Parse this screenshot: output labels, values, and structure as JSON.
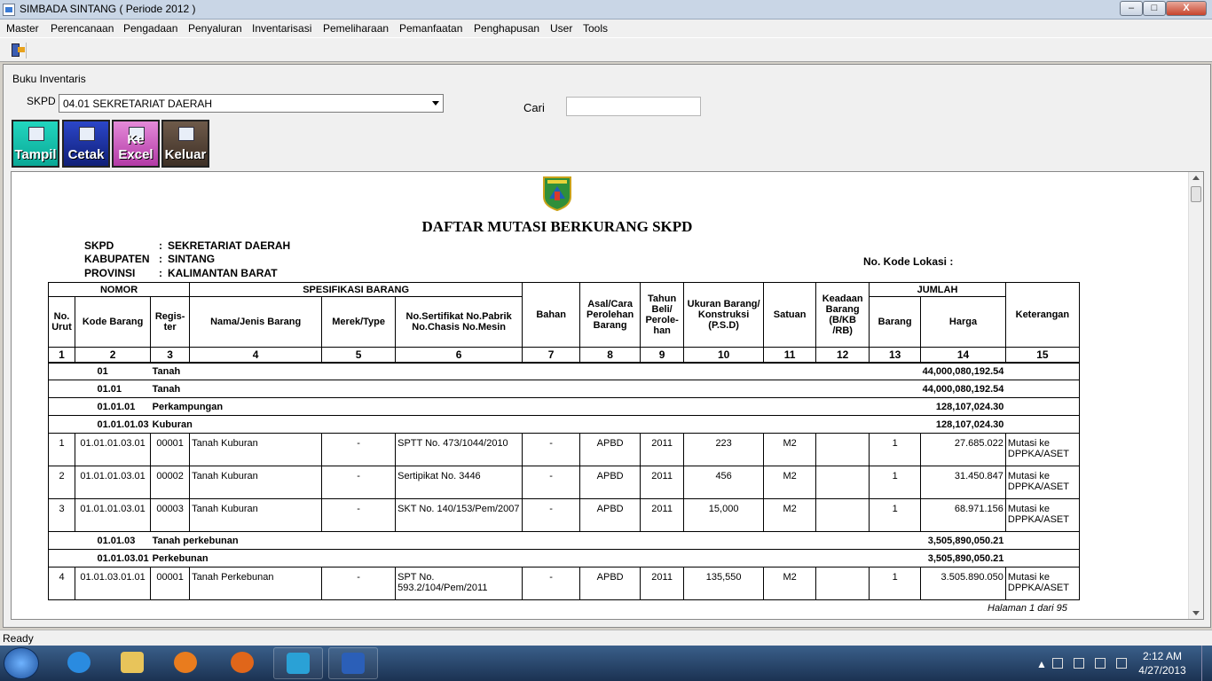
{
  "window": {
    "title": "SIMBADA SINTANG ( Periode 2012 )",
    "min": "–",
    "max": "□",
    "close": "X"
  },
  "menu": [
    "Master",
    "Perencanaan",
    "Pengadaan",
    "Penyaluran",
    "Inventarisasi",
    "Pemeliharaan",
    "Pemanfaatan",
    "Penghapusan",
    "User",
    "Tools"
  ],
  "frame": {
    "title": "Buku Inventaris"
  },
  "filters": {
    "skpd_label": "SKPD",
    "skpd_value": "04.01 SEKRETARIAT DAERAH",
    "cari_label": "Cari",
    "cari_value": ""
  },
  "buttons": {
    "tampil": "Tampil",
    "cetak": "Cetak",
    "excel": "Ke Excel",
    "keluar": "Keluar"
  },
  "report": {
    "title": "DAFTAR MUTASI BERKURANG SKPD",
    "skpd_label": "SKPD",
    "skpd_value": "SEKRETARIAT DAERAH",
    "kabupaten_label": "KABUPATEN",
    "kabupaten_value": "SINTANG",
    "provinsi_label": "PROVINSI",
    "provinsi_value": "KALIMANTAN BARAT",
    "kode_lokasi": "No. Kode Lokasi :",
    "colon": ":",
    "headers": {
      "nomor": "NOMOR",
      "spesifikasi": "SPESIFIKASI BARANG",
      "jumlah": "JUMLAH",
      "no_urut": "No. Urut",
      "kode_barang": "Kode Barang",
      "register": "Regis- ter",
      "nama": "Nama/Jenis Barang",
      "merek": "Merek/Type",
      "sertifikat": "No.Sertifikat No.Pabrik No.Chasis No.Mesin",
      "bahan": "Bahan",
      "asal": "Asal/Cara Perolehan Barang",
      "tahun": "Tahun Beli/ Perole- han",
      "ukuran": "Ukuran Barang/ Konstruksi (P.S.D)",
      "satuan": "Satuan",
      "keadaan": "Keadaan Barang (B/KB /RB)",
      "barang": "Barang",
      "harga": "Harga",
      "keterangan": "Keterangan",
      "col_numbers": [
        "1",
        "2",
        "3",
        "4",
        "5",
        "6",
        "7",
        "8",
        "9",
        "10",
        "11",
        "12",
        "13",
        "14",
        "15"
      ]
    },
    "rows": [
      {
        "type": "group",
        "code": "01",
        "name": "Tanah",
        "total": "44,000,080,192.54"
      },
      {
        "type": "group",
        "code": "01.01",
        "name": "Tanah",
        "total": "44,000,080,192.54"
      },
      {
        "type": "group",
        "code": "01.01.01",
        "name": "Perkampungan",
        "total": "128,107,024.30"
      },
      {
        "type": "group",
        "code": "01.01.01.03",
        "name": "Kuburan",
        "total": "128,107,024.30"
      },
      {
        "type": "item",
        "no": "1",
        "kode": "01.01.01.03.01",
        "reg": "00001",
        "nama": "Tanah Kuburan",
        "merek": "-",
        "sertifikat": "SPTT No. 473/1044/2010",
        "bahan": "-",
        "asal": "APBD",
        "tahun": "2011",
        "ukuran": "223",
        "satuan": "M2",
        "keadaan": "",
        "barang": "1",
        "harga": "27.685.022",
        "ket": "Mutasi ke DPPKA/ASET"
      },
      {
        "type": "item",
        "no": "2",
        "kode": "01.01.01.03.01",
        "reg": "00002",
        "nama": "Tanah Kuburan",
        "merek": "-",
        "sertifikat": "Sertipikat No. 3446",
        "bahan": "-",
        "asal": "APBD",
        "tahun": "2011",
        "ukuran": "456",
        "satuan": "M2",
        "keadaan": "",
        "barang": "1",
        "harga": "31.450.847",
        "ket": "Mutasi ke DPPKA/ASET"
      },
      {
        "type": "item",
        "no": "3",
        "kode": "01.01.01.03.01",
        "reg": "00003",
        "nama": "Tanah Kuburan",
        "merek": "-",
        "sertifikat": "SKT No. 140/153/Pem/2007",
        "bahan": "-",
        "asal": "APBD",
        "tahun": "2011",
        "ukuran": "15,000",
        "satuan": "M2",
        "keadaan": "",
        "barang": "1",
        "harga": "68.971.156",
        "ket": "Mutasi ke DPPKA/ASET"
      },
      {
        "type": "group",
        "code": "01.01.03",
        "name": "Tanah perkebunan",
        "total": "3,505,890,050.21"
      },
      {
        "type": "group",
        "code": "01.01.03.01",
        "name": "Perkebunan",
        "total": "3,505,890,050.21"
      },
      {
        "type": "item",
        "no": "4",
        "kode": "01.01.03.01.01",
        "reg": "00001",
        "nama": "Tanah Perkebunan",
        "merek": "-",
        "sertifikat": "SPT No. 593.2/104/Pem/2011",
        "bahan": "-",
        "asal": "APBD",
        "tahun": "2011",
        "ukuran": "135,550",
        "satuan": "M2",
        "keadaan": "",
        "barang": "1",
        "harga": "3.505.890.050",
        "ket": "Mutasi ke DPPKA/ASET"
      }
    ],
    "footer": "Halaman 1 dari 95"
  },
  "status": "Ready",
  "taskbar": {
    "time": "2:12 AM",
    "date": "4/27/2013"
  },
  "icons": [
    "windows-start-icon",
    "ie-icon",
    "explorer-icon",
    "media-player-icon",
    "firefox-icon",
    "simbada-app-icon",
    "word-icon"
  ]
}
